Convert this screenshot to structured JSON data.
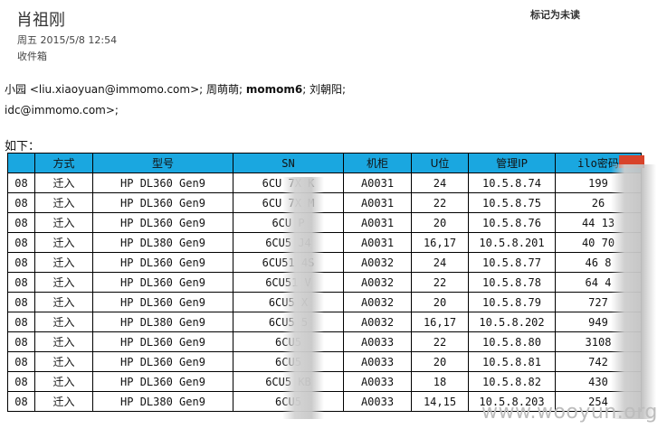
{
  "header": {
    "sender": "肖祖刚",
    "datetime": "周五 2015/5/8 12:54",
    "folder": "收件箱",
    "mark_unread": "标记为未读"
  },
  "recipients": {
    "line1_start": "小园 <liu.xiaoyuan@immomo.com>;  周萌萌;  ",
    "line1_bold": "momom6",
    "line1_end": ";  刘朝阳;",
    "line2": "idc@immomo.com>;"
  },
  "intro": "如下：",
  "table": {
    "headers": [
      "",
      "方式",
      "型号",
      "SN",
      "机柜",
      "U位",
      "管理IP",
      "ilo密码"
    ],
    "rows": [
      [
        "08",
        "迁入",
        "HP DL360 Gen9",
        "6CU 7X K",
        "A0031",
        "24",
        "10.5.8.74",
        "199"
      ],
      [
        "08",
        "迁入",
        "HP DL360 Gen9",
        "6CU 7X M",
        "A0031",
        "22",
        "10.5.8.75",
        "26"
      ],
      [
        "08",
        "迁入",
        "HP DL360 Gen9",
        "6CU P",
        "A0031",
        "20",
        "10.5.8.76",
        "44 13"
      ],
      [
        "08",
        "迁入",
        "HP DL380 Gen9",
        "6CU5 J4",
        "A0031",
        "16,17",
        "10.5.8.201",
        "40 70"
      ],
      [
        "08",
        "迁入",
        "HP DL360 Gen9",
        "6CU51 4S",
        "A0032",
        "24",
        "10.5.8.77",
        "46 8"
      ],
      [
        "08",
        "迁入",
        "HP DL360 Gen9",
        "6CU51 V",
        "A0032",
        "22",
        "10.5.8.78",
        "64 4"
      ],
      [
        "08",
        "迁入",
        "HP DL360 Gen9",
        "6CU5 X",
        "A0032",
        "20",
        "10.5.8.79",
        "727"
      ],
      [
        "08",
        "迁入",
        "HP DL380 Gen9",
        "6CU5 5",
        "A0032",
        "16,17",
        "10.5.8.202",
        "949"
      ],
      [
        "08",
        "迁入",
        "HP DL360 Gen9",
        "6CU5",
        "A0033",
        "22",
        "10.5.8.80",
        "3108"
      ],
      [
        "08",
        "迁入",
        "HP DL360 Gen9",
        "6CU5",
        "A0033",
        "20",
        "10.5.8.81",
        "742"
      ],
      [
        "08",
        "迁入",
        "HP DL360 Gen9",
        "6CU5 KB",
        "A0033",
        "18",
        "10.5.8.82",
        "430"
      ],
      [
        "08",
        "迁入",
        "HP DL380 Gen9",
        "6CU5",
        "A0033",
        "14,15",
        "10.5.8.203",
        "254"
      ]
    ]
  },
  "watermark": "www.wooyun.org",
  "colors": {
    "header_bg": "#1aa7e0",
    "tag_red": "#d8432a"
  }
}
